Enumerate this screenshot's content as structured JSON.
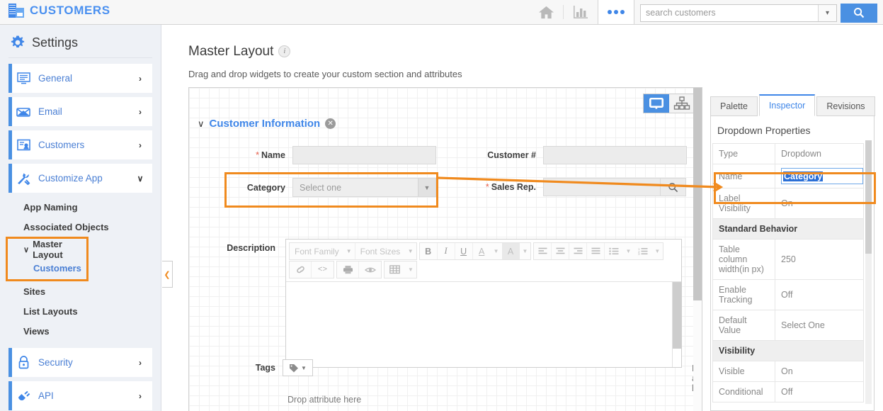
{
  "header": {
    "brand": "CUSTOMERS",
    "brand_icon": "building-icon",
    "home_icon": "home-icon",
    "reports_icon": "bar-chart-icon",
    "more_icon": "more-dots-icon",
    "search": {
      "placeholder": "search customers",
      "value": "",
      "dropdown_icon": "chevron-down-icon",
      "button_icon": "search-icon"
    },
    "accent_blue": "#4a90e2"
  },
  "sidebar": {
    "title": "Settings",
    "gear_icon": "gear-icon",
    "nav": [
      {
        "label": "General",
        "icon": "monitor-list-icon",
        "chevron": "›"
      },
      {
        "label": "Email",
        "icon": "envelope-icon",
        "chevron": "›"
      },
      {
        "label": "Customers",
        "icon": "customer-card-icon",
        "chevron": "›"
      },
      {
        "label": "Customize App",
        "icon": "tools-icon",
        "chevron": "∨"
      }
    ],
    "sub_items": [
      {
        "label": "App Naming"
      },
      {
        "label": "Associated Objects"
      }
    ],
    "highlighted_group": {
      "parent": {
        "label": "Master Layout",
        "caret": "∨"
      },
      "child": {
        "label": "Customers"
      }
    },
    "sub_items_after": [
      {
        "label": "Sites"
      },
      {
        "label": "List Layouts"
      },
      {
        "label": "Views"
      }
    ],
    "nav_bottom": [
      {
        "label": "Security",
        "icon": "lock-icon",
        "chevron": "›"
      },
      {
        "label": "API",
        "icon": "plug-icon",
        "chevron": "›"
      }
    ],
    "collapse_icon": "chevron-left-icon"
  },
  "main": {
    "title": "Master Layout",
    "info_icon": "info-icon",
    "subtitle": "Drag and drop widgets to create your custom section and attributes",
    "view_toggle": {
      "desktop_icon": "monitor-icon",
      "tree_icon": "sitemap-icon",
      "active": "desktop"
    },
    "section": {
      "caret": "∨",
      "name": "Customer Information",
      "close_icon": "close-icon"
    },
    "fields": {
      "name": {
        "label": "Name",
        "required": true,
        "value": ""
      },
      "customer_number": {
        "label": "Customer #",
        "required": false,
        "value": ""
      },
      "category": {
        "label": "Category",
        "required": false,
        "placeholder": "Select one",
        "caret_icon": "caret-down-icon"
      },
      "sales_rep": {
        "label": "Sales Rep.",
        "required": true,
        "value": "",
        "search_icon": "search-icon"
      },
      "description": {
        "label": "Description",
        "value": ""
      },
      "tags": {
        "label": "Tags",
        "icon": "tag-icon",
        "caret_icon": "caret-down-icon"
      }
    },
    "editor_toolbar": {
      "font_family": "Font Family",
      "font_sizes": "Font Sizes",
      "buttons": [
        {
          "name": "bold",
          "glyph": "B"
        },
        {
          "name": "italic",
          "glyph": "I"
        },
        {
          "name": "underline",
          "glyph": "U"
        },
        {
          "name": "text-color",
          "glyph": "A"
        },
        {
          "name": "background-color",
          "glyph": "A"
        },
        {
          "name": "align-left",
          "glyph": "≡"
        },
        {
          "name": "align-center",
          "glyph": "≡"
        },
        {
          "name": "align-right",
          "glyph": "≡"
        },
        {
          "name": "align-justify",
          "glyph": "≡"
        },
        {
          "name": "bullet-list",
          "glyph": "☰"
        },
        {
          "name": "numbered-list",
          "glyph": "☰"
        },
        {
          "name": "link",
          "glyph": "⚭"
        },
        {
          "name": "source-code",
          "glyph": "<>"
        },
        {
          "name": "print",
          "glyph": "⎙"
        },
        {
          "name": "preview",
          "glyph": "◉"
        },
        {
          "name": "table",
          "glyph": "▦"
        }
      ]
    },
    "drop_hints": [
      "Drop attribute here",
      "Drop attribute here"
    ],
    "highlight_color": "#f08a1e"
  },
  "inspector": {
    "tabs": [
      {
        "label": "Palette",
        "active": false
      },
      {
        "label": "Inspector",
        "active": true
      },
      {
        "label": "Revisions",
        "active": false
      }
    ],
    "panel_title": "Dropdown Properties",
    "rows": [
      {
        "key": "Type",
        "value": "Dropdown",
        "kind": "text"
      },
      {
        "key": "Name",
        "value": "Category",
        "kind": "input-selected"
      },
      {
        "key": "Label Visibility",
        "value": "On",
        "kind": "text"
      },
      {
        "key": "Standard Behavior",
        "value": "",
        "kind": "section"
      },
      {
        "key": "Table column width(in px)",
        "value": "250",
        "kind": "text"
      },
      {
        "key": "Enable Tracking",
        "value": "Off",
        "kind": "text"
      },
      {
        "key": "Default Value",
        "value": "Select One",
        "kind": "text"
      },
      {
        "key": "Visibility",
        "value": "",
        "kind": "section"
      },
      {
        "key": "Visible",
        "value": "On",
        "kind": "text"
      },
      {
        "key": "Conditional",
        "value": "Off",
        "kind": "text"
      }
    ]
  }
}
